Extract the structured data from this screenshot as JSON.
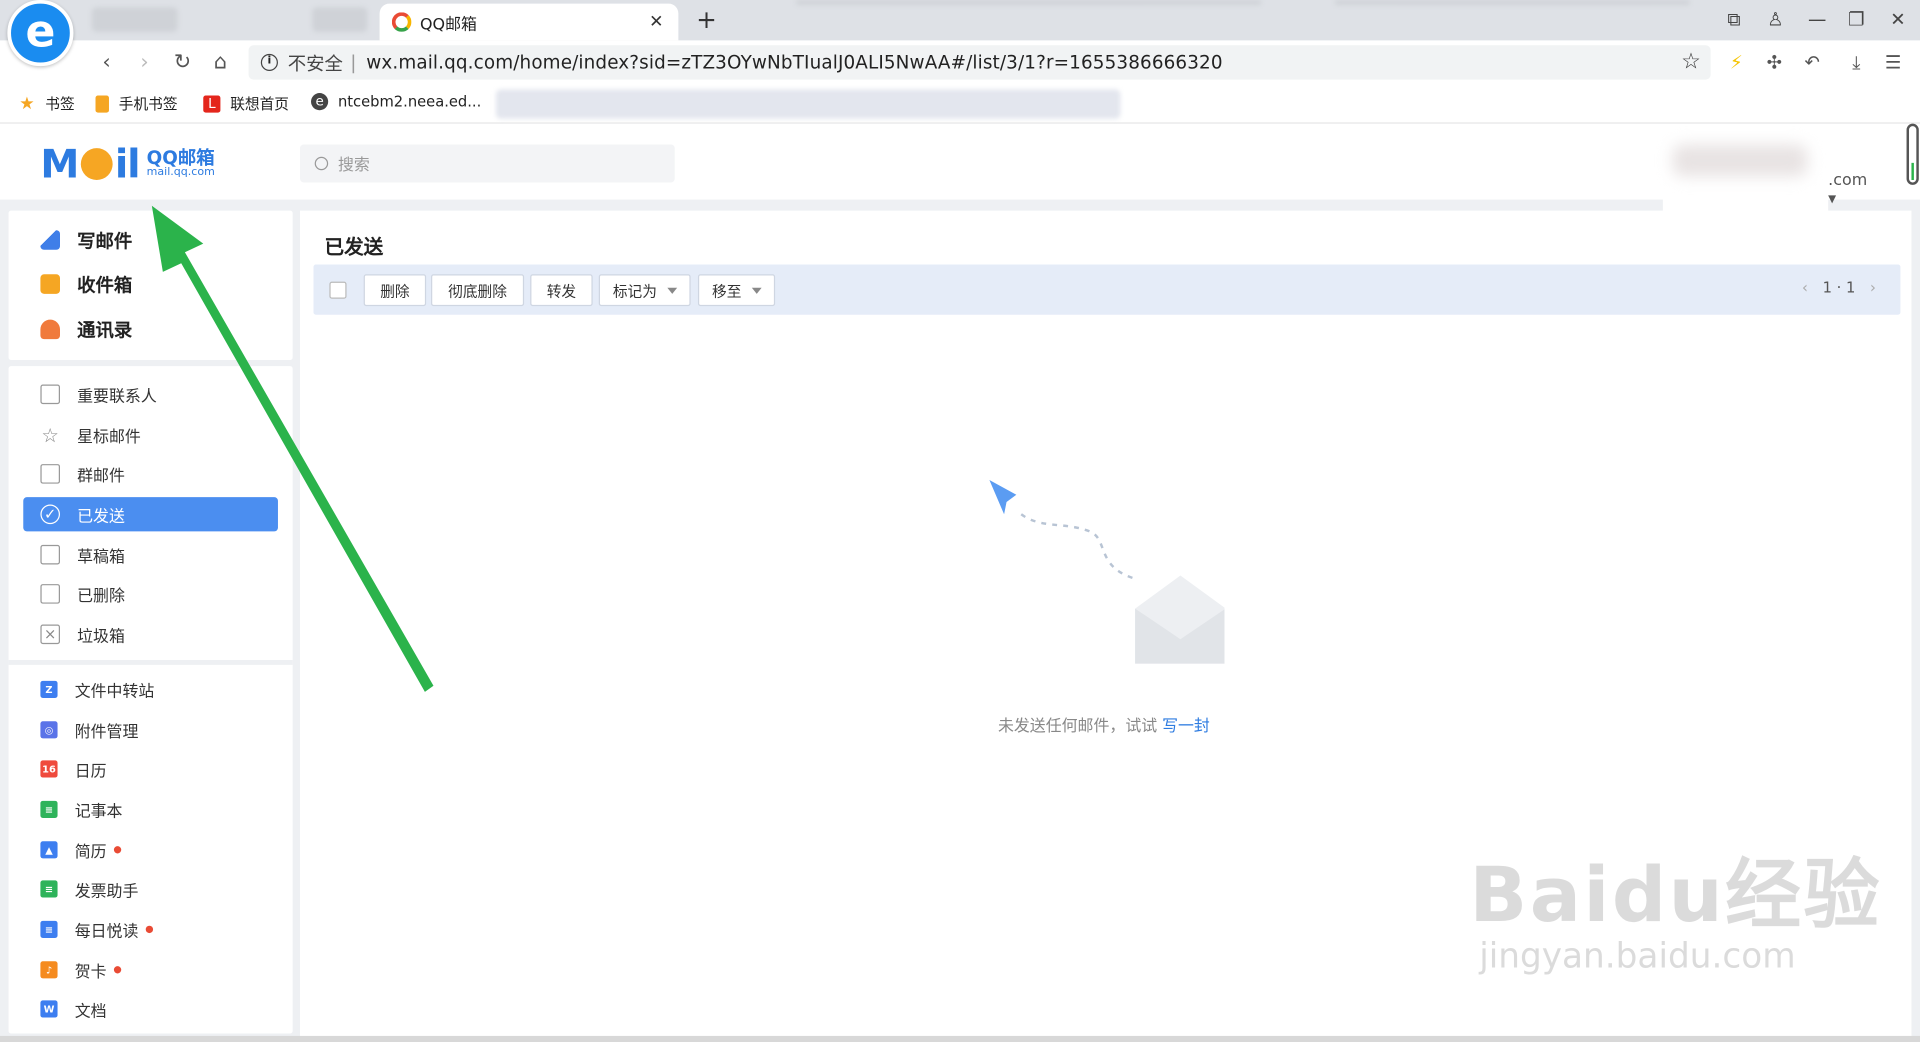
{
  "browser": {
    "tab_title": "QQ邮箱",
    "security_label": "不安全",
    "separator": "|",
    "url": "wx.mail.qq.com/home/index?sid=zTZ3OYwNbTIualJ0ALI5NwAA#/list/3/1?r=1655386666320",
    "bookmarks": [
      {
        "label": "书签",
        "icon": "star-icon",
        "color": "#f5a623"
      },
      {
        "label": "手机书签",
        "icon": "phone-icon",
        "color": "#f5a623"
      },
      {
        "label": "联想首页",
        "icon": "lenovo-icon",
        "color": "#e4261c"
      },
      {
        "label": "ntcebm2.neea.ed...",
        "icon": "globe-icon",
        "color": "#444444"
      }
    ]
  },
  "mail": {
    "brand": "QQ邮箱",
    "brand_domain": "mail.qq.com",
    "search_placeholder": "搜索",
    "user_domain_suffix": ".com",
    "nav_primary": [
      {
        "label": "写邮件",
        "icon": "compose-icon",
        "color": "#3f7ee8"
      },
      {
        "label": "收件箱",
        "icon": "inbox-icon",
        "color": "#f5a623"
      },
      {
        "label": "通讯录",
        "icon": "contacts-icon",
        "color": "#f07a3c"
      }
    ],
    "folders": [
      {
        "label": "重要联系人",
        "icon": "bookmark-icon"
      },
      {
        "label": "星标邮件",
        "icon": "star-outline-icon"
      },
      {
        "label": "群邮件",
        "icon": "group-icon"
      },
      {
        "label": "已发送",
        "icon": "check-circle-icon",
        "active": true
      },
      {
        "label": "草稿箱",
        "icon": "draft-icon"
      },
      {
        "label": "已删除",
        "icon": "trash-icon"
      },
      {
        "label": "垃圾箱",
        "icon": "spam-icon"
      }
    ],
    "apps": [
      {
        "label": "文件中转站",
        "icon": "file-transfer-icon",
        "color": "#3d7ef0",
        "glyph": "Z",
        "dot": false
      },
      {
        "label": "附件管理",
        "icon": "attachment-icon",
        "color": "#5a73e8",
        "glyph": "◎",
        "dot": false
      },
      {
        "label": "日历",
        "icon": "calendar-icon",
        "color": "#ef4a3d",
        "glyph": "16",
        "dot": false
      },
      {
        "label": "记事本",
        "icon": "notebook-icon",
        "color": "#2eb35a",
        "glyph": "≡",
        "dot": false
      },
      {
        "label": "简历",
        "icon": "resume-icon",
        "color": "#3d7ef0",
        "glyph": "▲",
        "dot": true
      },
      {
        "label": "发票助手",
        "icon": "invoice-icon",
        "color": "#2eb35a",
        "glyph": "≡",
        "dot": false
      },
      {
        "label": "每日悦读",
        "icon": "reading-icon",
        "color": "#3d7ef0",
        "glyph": "≡",
        "dot": true
      },
      {
        "label": "贺卡",
        "icon": "greeting-card-icon",
        "color": "#f58b1f",
        "glyph": "♪",
        "dot": true
      },
      {
        "label": "文档",
        "icon": "document-icon",
        "color": "#3d7ef0",
        "glyph": "W",
        "dot": false
      }
    ],
    "main": {
      "title": "已发送",
      "toolbar": {
        "delete": "删除",
        "delete_permanent": "彻底删除",
        "forward": "转发",
        "mark_as": "标记为",
        "move_to": "移至",
        "pager": "1 · 1"
      },
      "empty_message": "未发送任何邮件，试试",
      "empty_link": "写一封"
    }
  },
  "watermark": {
    "line1": "Bai",
    "line1b": "du",
    "line1c": "经验",
    "line2": "jingyan.baidu.com"
  },
  "colors": {
    "accent": "#4b8ef0",
    "arrow": "#2bb34b"
  }
}
